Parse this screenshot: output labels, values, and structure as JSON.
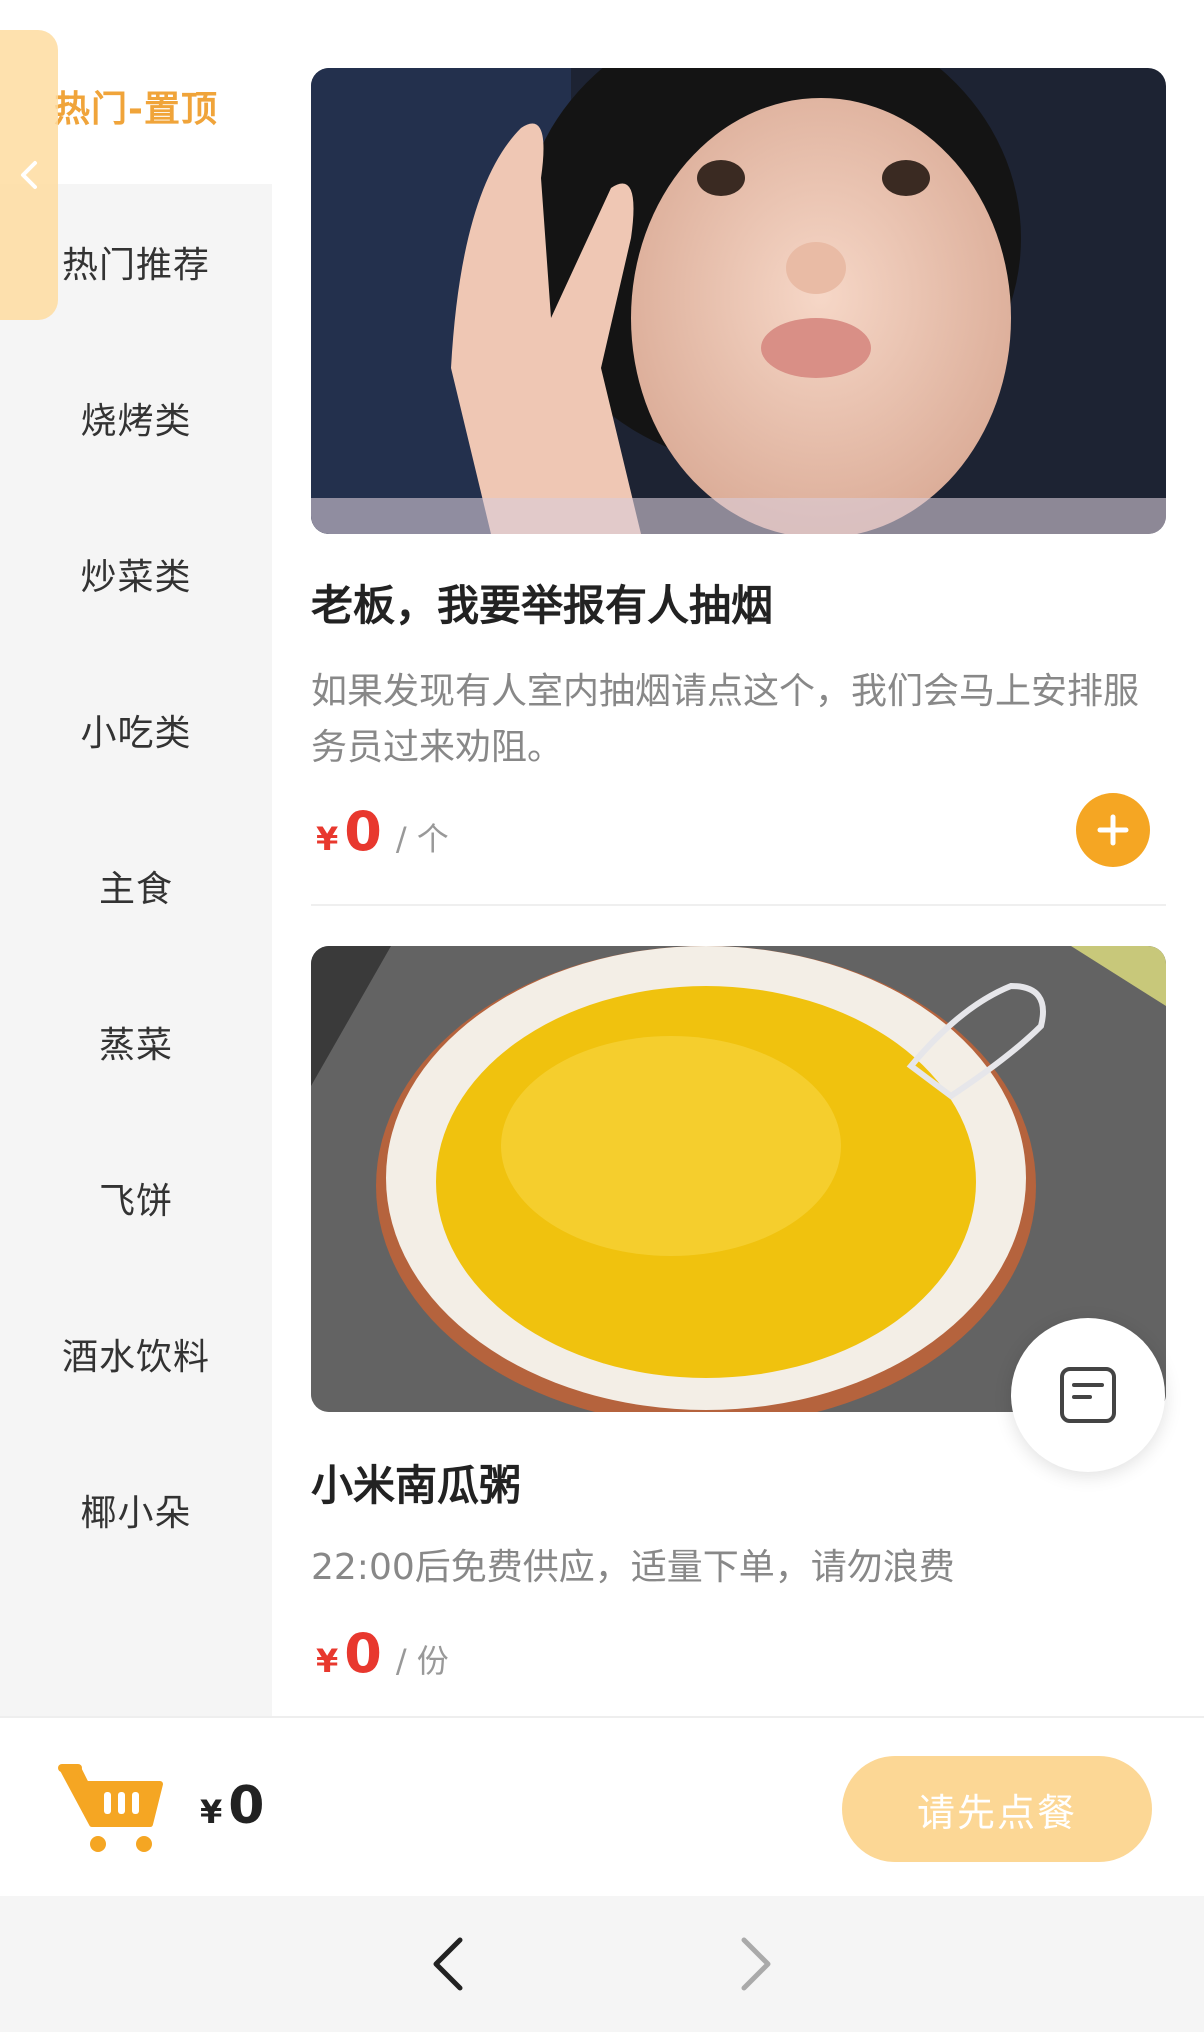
{
  "sidebar": {
    "items": [
      {
        "label": "热门-置顶",
        "active": true
      },
      {
        "label": "热门推荐"
      },
      {
        "label": "烧烤类"
      },
      {
        "label": "炒菜类"
      },
      {
        "label": "小吃类"
      },
      {
        "label": "主食"
      },
      {
        "label": "蒸菜"
      },
      {
        "label": "飞饼"
      },
      {
        "label": "酒水饮料"
      },
      {
        "label": "椰小朵"
      }
    ]
  },
  "dishes": [
    {
      "title": "老板，我要举报有人抽烟",
      "description": "如果发现有人室内抽烟请点这个，我们会马上安排服务员过来劝阻。",
      "price_symbol": "¥",
      "price": "0",
      "unit": "/ 个",
      "image_icon": "child-photo"
    },
    {
      "title": "小米南瓜粥",
      "description": "22:00后免费供应，适量下单，请勿浪费",
      "price_symbol": "¥",
      "price": "0",
      "unit": "/ 份",
      "image_icon": "pumpkin-porridge-photo"
    }
  ],
  "cart": {
    "total_symbol": "¥",
    "total": "0",
    "order_button": "请先点餐"
  },
  "colors": {
    "accent": "#f5a623",
    "price": "#e8382e",
    "order_button_disabled": "#fcd795"
  }
}
